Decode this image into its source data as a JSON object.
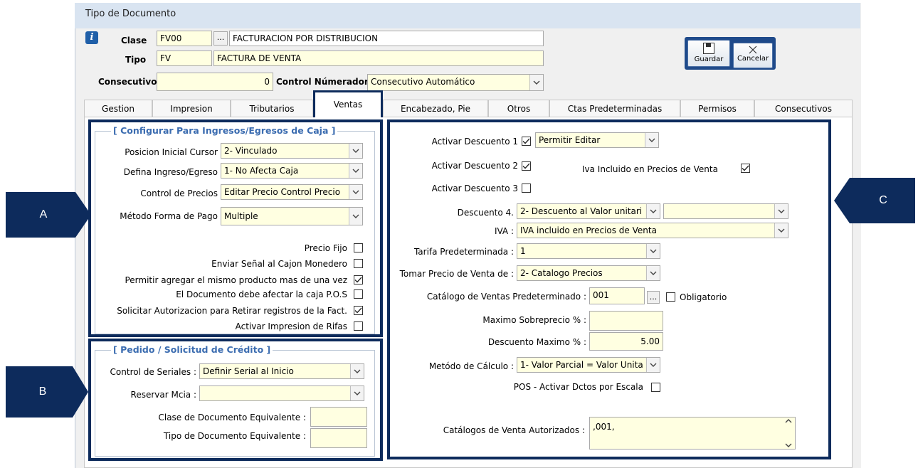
{
  "window": {
    "title": "Tipo de Documento"
  },
  "header": {
    "clase_label": "Clase",
    "clase_code": "FV00",
    "clase_dots": "...",
    "clase_desc": "FACTURACION POR DISTRIBUCION",
    "tipo_label": "Tipo",
    "tipo_code": "FV",
    "tipo_desc": "FACTURA DE VENTA",
    "consec_label": "Consecutivo",
    "consec_value": "0",
    "control_label": "Control Númerador :",
    "control_value": "Consecutivo Automático"
  },
  "buttons": {
    "guardar": "Guardar",
    "cancelar": "Cancelar"
  },
  "tabs": [
    "Gestion",
    "Impresion",
    "Tributarios",
    "Ventas",
    "Encabezado, Pie",
    "Otros",
    "Ctas Predeterminadas",
    "Permisos",
    "Consecutivos"
  ],
  "groupA": {
    "title": "[ Configurar Para  Ingresos/Egresos de Caja ]",
    "pos_label": "Posicion Inicial Cursor",
    "pos_value": "2- Vinculado",
    "ing_label": "Defina Ingreso/Egreso",
    "ing_value": "1- No Afecta Caja",
    "ctrl_label": "Control de Precios",
    "ctrl_value": "Editar Precio Control Precio",
    "met_label": "Método Forma de Pago",
    "met_value": "Multiple",
    "checks": [
      {
        "label": "Precio Fijo",
        "checked": false
      },
      {
        "label": "Enviar Señal al Cajon Monedero",
        "checked": false
      },
      {
        "label": "Permitir agregar el mismo producto mas de una vez",
        "checked": true
      },
      {
        "label": "El Documento debe afectar la caja P.O.S",
        "checked": false
      },
      {
        "label": "Solicitar Autorizacion para Retirar registros de la Fact.",
        "checked": true
      },
      {
        "label": "Activar Impresion de Rifas",
        "checked": false
      }
    ]
  },
  "groupB": {
    "title": "[ Pedido / Solicitud de Crédito ]",
    "seriales_label": "Control de Seriales :",
    "seriales_value": "Definir Serial al Inicio",
    "reservar_label": "Reservar Mcia :",
    "reservar_value": "",
    "clase_eq_label": "Clase  de Documento Equivalente :",
    "tipo_eq_label": "Tipo  de Documento Equivalente :"
  },
  "groupC": {
    "desc1_label": "Activar Descuento 1",
    "desc1_checked": true,
    "desc1_combo": "Permitir Editar",
    "desc2_label": "Activar Descuento 2",
    "desc2_checked": true,
    "iva_incl_label": "Iva Incluido en  Precios de Venta",
    "iva_incl_checked": true,
    "desc3_label": "Activar Descuento 3",
    "desc3_checked": false,
    "desc4_label": "Descuento 4.",
    "desc4_value": "2- Descuento al Valor unitari",
    "desc4_value2": "",
    "iva_label": "IVA :",
    "iva_value": "IVA incluido en Precios de Venta",
    "tarifa_label": "Tarifa Predeterminada :",
    "tarifa_value": "1",
    "tomar_label": "Tomar Precio de Venta de :",
    "tomar_value": "2- Catalogo Precios",
    "catalogo_label": "Catálogo de Ventas Predeterminado :",
    "catalogo_value": "001",
    "catalogo_dots": "...",
    "obligatorio_label": "Obligatorio",
    "max_sobre_label": "Maximo Sobreprecio % :",
    "max_sobre_value": "",
    "desc_max_label": "Descuento Maximo  % :",
    "desc_max_value": "5.00",
    "metodo_label": "Metódo de Cálculo :",
    "metodo_value": "1- Valor Parcial = Valor Unita",
    "pos_label": "POS - Activar Dctos por Escala",
    "pos_checked": false,
    "cat_aut_label": "Catálogos de Venta Autorizados :",
    "cat_aut_value": ",001,"
  },
  "callouts": {
    "a": "A",
    "b": "B",
    "c": "C"
  },
  "colors": {
    "accent": "#0d2b5c",
    "field_bg": "#ffffe1",
    "group_title": "#3b6cb0"
  }
}
